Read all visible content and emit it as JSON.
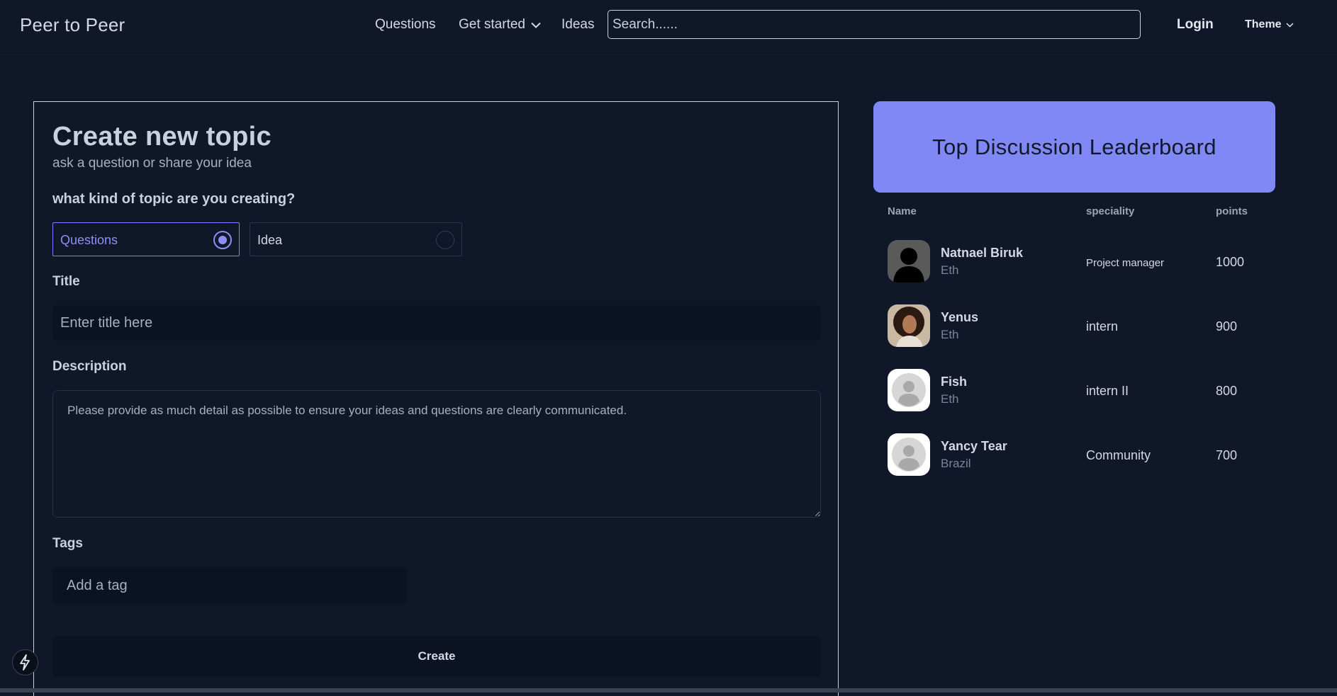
{
  "header": {
    "brand": "Peer to Peer",
    "nav": {
      "questions": "Questions",
      "get_started": "Get started",
      "ideas": "Ideas"
    },
    "search_placeholder": "Search......",
    "login": "Login",
    "theme": "Theme"
  },
  "form": {
    "title": "Create new topic",
    "subtitle": "ask a question or share your idea",
    "kind_label": "what kind of topic are you creating?",
    "options": [
      {
        "label": "Questions",
        "selected": true
      },
      {
        "label": "Idea",
        "selected": false
      }
    ],
    "title_label": "Title",
    "title_placeholder": "Enter title here",
    "description_label": "Description",
    "description_placeholder": "Please provide as much detail as possible to ensure your ideas and questions are clearly communicated.",
    "tags_label": "Tags",
    "tags_placeholder": "Add a tag",
    "create_button": "Create"
  },
  "leaderboard": {
    "title": "Top Discussion Leaderboard",
    "columns": {
      "name": "Name",
      "speciality": "speciality",
      "points": "points"
    },
    "rows": [
      {
        "name": "Natnael Biruk",
        "country": "Eth",
        "speciality": "Project manager",
        "points": "1000",
        "avatar": "silhouette-avatar"
      },
      {
        "name": "Yenus",
        "country": "Eth",
        "speciality": "intern",
        "points": "900",
        "avatar": "photo-avatar"
      },
      {
        "name": "Fish",
        "country": "Eth",
        "speciality": "intern II",
        "points": "800",
        "avatar": "default-avatar"
      },
      {
        "name": "Yancy Tear",
        "country": "Brazil",
        "speciality": "Community",
        "points": "700",
        "avatar": "default-avatar"
      }
    ]
  },
  "colors": {
    "background": "#0f1729",
    "accent": "#8088f6",
    "input_bg": "#0b1221"
  }
}
